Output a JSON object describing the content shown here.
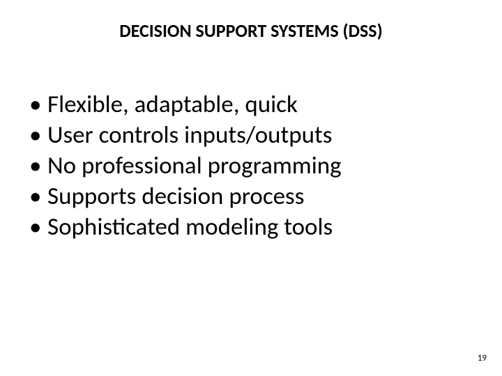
{
  "title": "DECISION SUPPORT SYSTEMS (DSS)",
  "bullets": [
    "Flexible, adaptable, quick",
    "User controls inputs/outputs",
    "No professional programming",
    "Supports decision process",
    "Sophisticated modeling tools"
  ],
  "pageNumber": "19"
}
